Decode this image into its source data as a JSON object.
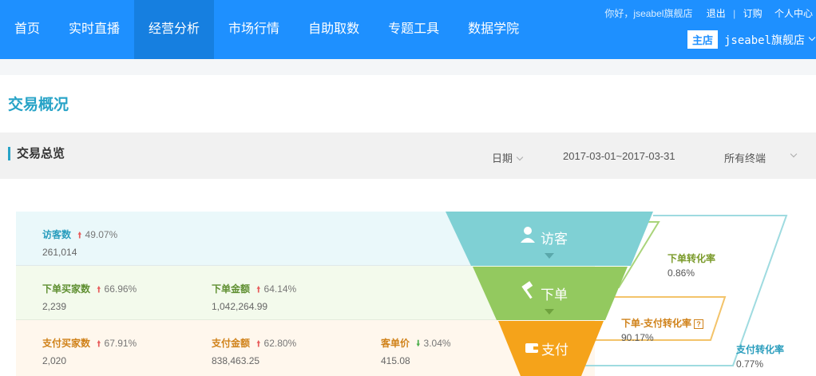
{
  "nav": {
    "items": [
      {
        "label": "首页"
      },
      {
        "label": "实时直播"
      },
      {
        "label": "经营分析"
      },
      {
        "label": "市场行情"
      },
      {
        "label": "自助取数"
      },
      {
        "label": "专题工具"
      },
      {
        "label": "数据学院"
      }
    ],
    "active_index": 2
  },
  "user": {
    "greeting": "你好，jseabel旗舰店",
    "logout": "退出",
    "sep": "|",
    "subscribe": "订购",
    "personal_center": "个人中心",
    "shop_badge": "主店",
    "shop_name": "jseabel旗舰店"
  },
  "page": {
    "title": "交易概况"
  },
  "section": {
    "title": "交易总览",
    "date_label": "日期",
    "date_range": "2017-03-01~2017-03-31",
    "terminal": "所有终端"
  },
  "metrics": {
    "visitors": {
      "label": "访客数",
      "pct": "49.07%",
      "value": "261,014"
    },
    "order_buyers": {
      "label": "下单买家数",
      "pct": "66.96%",
      "value": "2,239"
    },
    "order_amount": {
      "label": "下单金额",
      "pct": "64.14%",
      "value": "1,042,264.99"
    },
    "pay_buyers": {
      "label": "支付买家数",
      "pct": "67.91%",
      "value": "2,020"
    },
    "pay_amount": {
      "label": "支付金额",
      "pct": "62.80%",
      "value": "838,463.25"
    },
    "unit_price": {
      "label": "客单价",
      "pct": "3.04%",
      "value": "415.08"
    }
  },
  "funnel": {
    "stages": [
      {
        "label": "访客"
      },
      {
        "label": "下单"
      },
      {
        "label": "支付"
      }
    ]
  },
  "conversion": {
    "order_rate": {
      "label": "下单转化率",
      "value": "0.86%"
    },
    "order_pay_rate": {
      "label": "下单-支付转化率",
      "value": "90.17%"
    },
    "pay_rate": {
      "label": "支付转化率",
      "value": "0.77%"
    }
  },
  "colors": {
    "nav_bg": "#1e90ff",
    "visitor": "#7fd0d4",
    "order": "#93c95f",
    "pay": "#f5a31a"
  },
  "icons": [
    "user-icon",
    "hammer-icon",
    "wallet-icon",
    "up-arrow-icon",
    "down-arrow-icon",
    "help-icon",
    "chevron-down-icon"
  ]
}
